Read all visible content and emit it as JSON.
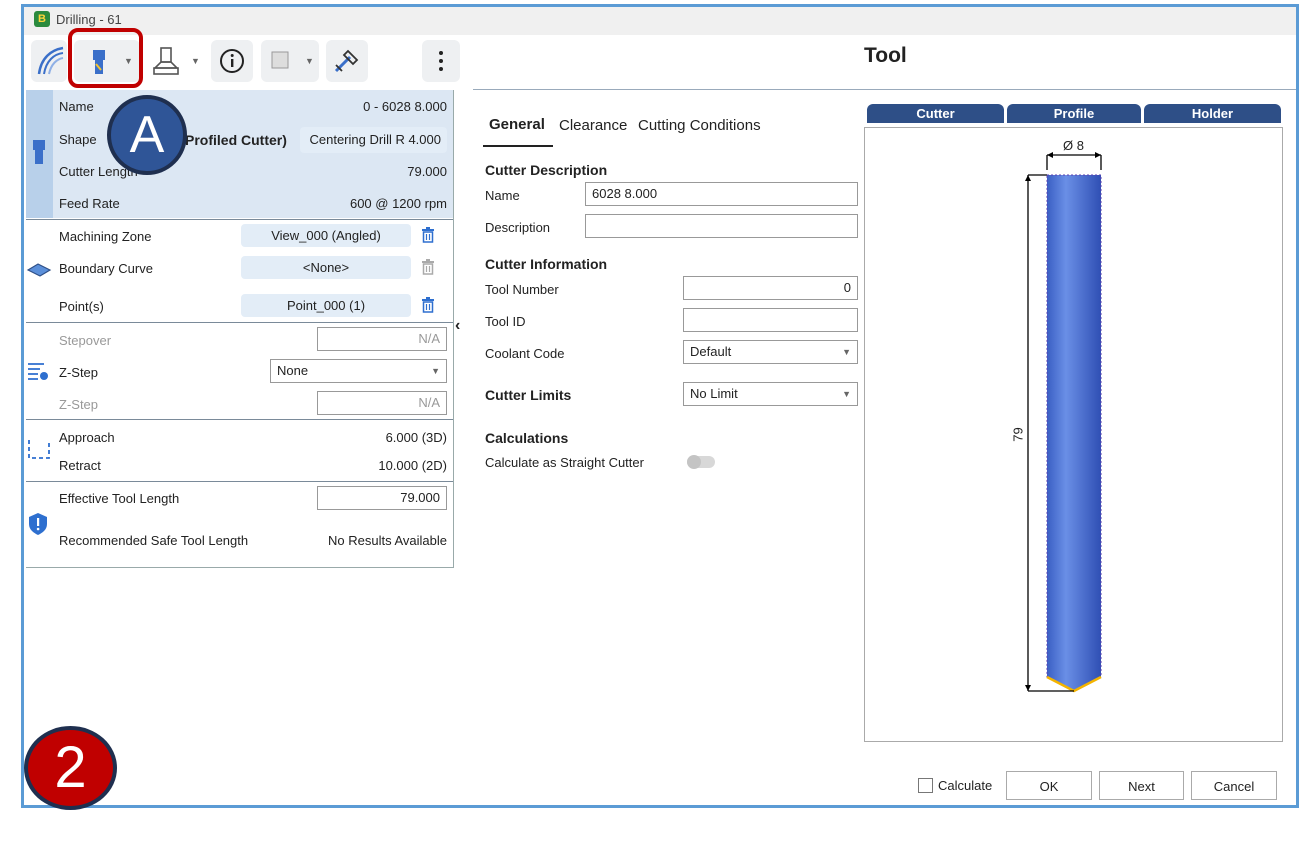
{
  "window": {
    "title": "Drilling - 61",
    "app_icon_text": "B"
  },
  "toolbar": {
    "buttons": [
      "toolpath-icon",
      "tool-icon",
      "holder-icon",
      "info-icon",
      "stock-icon",
      "setup-icon",
      "more-menu-icon"
    ]
  },
  "annotations": {
    "badge_a": "A",
    "badge_2": "2"
  },
  "heading": "Tool",
  "left_panel": {
    "tool": {
      "name_label": "Name",
      "name_value": "0 - 6028 8.000",
      "shape_label": "Shape",
      "shape_profiled": "Profiled Cutter)",
      "shape_value": "Centering Drill R 4.000",
      "length_label": "Cutter Length",
      "length_value": "79.000",
      "feed_label": "Feed Rate",
      "feed_value": "600 @ 1200 rpm"
    },
    "zone": {
      "machining_label": "Machining Zone",
      "machining_value": "View_000 (Angled)",
      "boundary_label": "Boundary Curve",
      "boundary_value": "<None>",
      "points_label": "Point(s)",
      "points_value": "Point_000 (1)"
    },
    "step": {
      "stepover_label": "Stepover",
      "stepover_value": "N/A",
      "zstep_label": "Z-Step",
      "zstep_select": "None",
      "zstep2_label": "Z-Step",
      "zstep2_value": "N/A"
    },
    "links": {
      "approach_label": "Approach",
      "approach_value": "6.000 (3D)",
      "retract_label": "Retract",
      "retract_value": "10.000 (2D)"
    },
    "safety": {
      "etl_label": "Effective Tool Length",
      "etl_value": "79.000",
      "rstl_label": "Recommended Safe Tool Length",
      "rstl_value": "No Results Available"
    },
    "collapse_glyph": "‹"
  },
  "middle": {
    "tabs": [
      "General",
      "Clearance",
      "Cutting Conditions"
    ],
    "active_tab": 0,
    "cutter_description": {
      "heading": "Cutter Description",
      "name_label": "Name",
      "name_value": "6028 8.000",
      "desc_label": "Description",
      "desc_value": ""
    },
    "cutter_information": {
      "heading": "Cutter Information",
      "tool_number_label": "Tool Number",
      "tool_number_value": "0",
      "tool_id_label": "Tool ID",
      "tool_id_value": "",
      "coolant_label": "Coolant Code",
      "coolant_value": "Default"
    },
    "cutter_limits": {
      "heading": "Cutter Limits",
      "value": "No Limit"
    },
    "calculations": {
      "heading": "Calculations",
      "straight_label": "Calculate as Straight Cutter",
      "straight_on": false
    }
  },
  "preview": {
    "tabs": [
      "Cutter",
      "Profile",
      "Holder"
    ],
    "diameter_label": "Ø 8",
    "length_label": "79"
  },
  "footer": {
    "calculate_label": "Calculate",
    "calculate_checked": false,
    "ok_label": "OK",
    "next_label": "Next",
    "cancel_label": "Cancel"
  },
  "colors": {
    "accent": "#2e4f87",
    "tool_blue": "#4a72d6",
    "highlight_red": "#c00000",
    "frame_blue": "#5b9bd5"
  }
}
